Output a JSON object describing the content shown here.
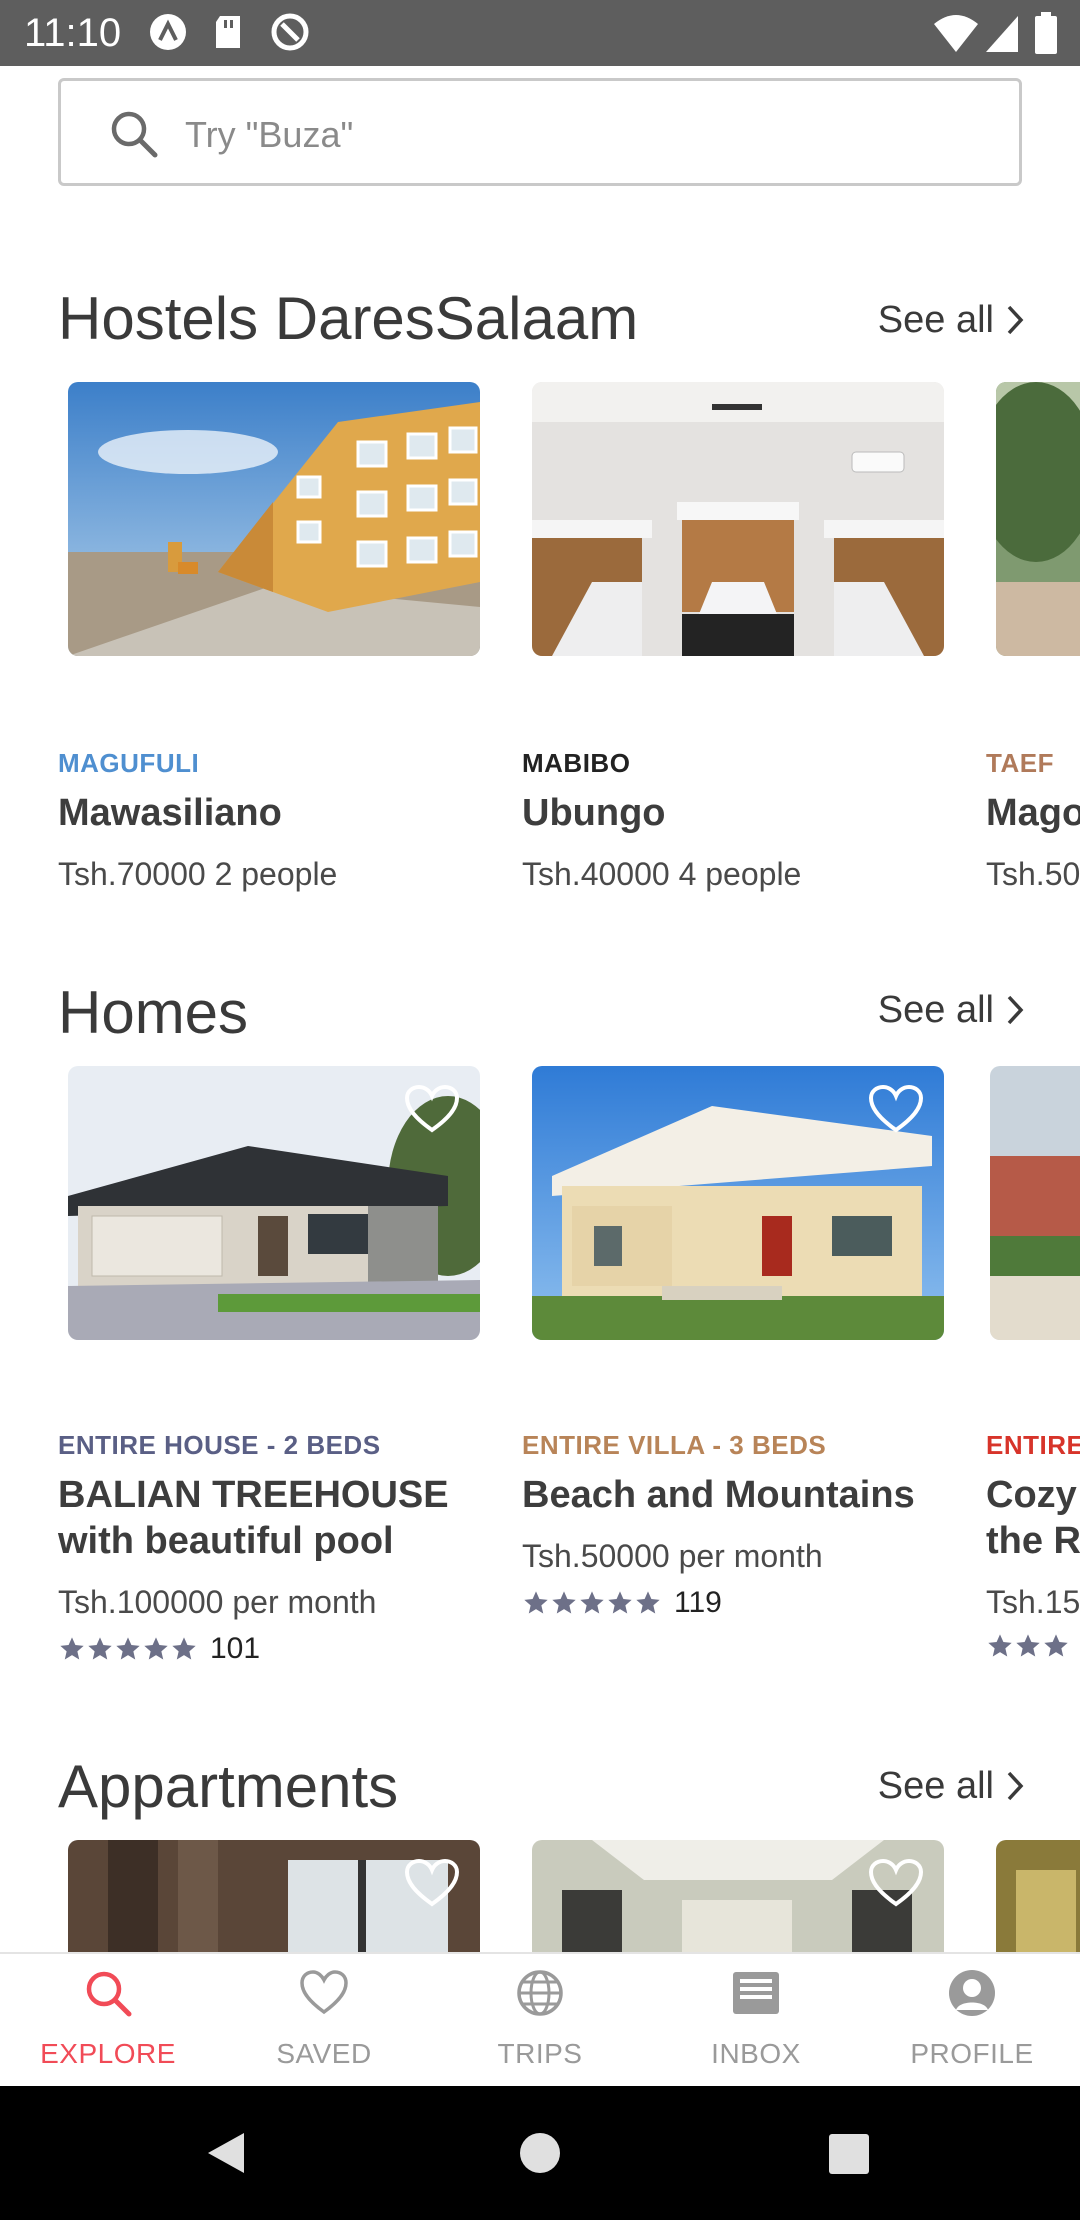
{
  "status_bar": {
    "time": "11:10"
  },
  "search": {
    "placeholder": "Try \"Buza\""
  },
  "sections": {
    "hostels": {
      "title": "Hostels DaresSalaam",
      "see_all": "See all",
      "cards": [
        {
          "area": "MAGUFULI",
          "area_color": "#4f8fd0",
          "name": "Mawasiliano",
          "price": "Tsh.70000 2 people"
        },
        {
          "area": "MABIBO",
          "area_color": "#222222",
          "name": "Ubungo",
          "price": "Tsh.40000 4 people"
        },
        {
          "area": "TAEF",
          "area_color": "#b07a5a",
          "name": "Mago",
          "price": "Tsh.50"
        }
      ]
    },
    "homes": {
      "title": "Homes",
      "see_all": "See all",
      "cards": [
        {
          "type": "ENTIRE HOUSE - 2 BEDS",
          "type_color": "#5a5f85",
          "name_line1": "BALIAN TREEHOUSE",
          "name_line2": "with beautiful pool",
          "price": "Tsh.100000 per month",
          "rating": 5,
          "reviews": "101"
        },
        {
          "type": "ENTIRE VILLA - 3 BEDS",
          "type_color": "#b88458",
          "name_line1": "Beach and Mountains",
          "name_line2": "",
          "price": "Tsh.50000 per month",
          "rating": 5,
          "reviews": "119"
        },
        {
          "type": "ENTIRE",
          "type_color": "#d7342a",
          "name_line1": "Cozy",
          "name_line2": "the R",
          "price": "Tsh.15",
          "rating": 5,
          "reviews": ""
        }
      ]
    },
    "apartments": {
      "title": "Appartments",
      "see_all": "See all"
    }
  },
  "bottom_nav": {
    "explore": "EXPLORE",
    "saved": "SAVED",
    "trips": "TRIPS",
    "inbox": "INBOX",
    "profile": "PROFILE"
  },
  "colors": {
    "accent": "#f14b57",
    "star": "#6d7088",
    "nav_inactive": "#9a9a9a"
  }
}
